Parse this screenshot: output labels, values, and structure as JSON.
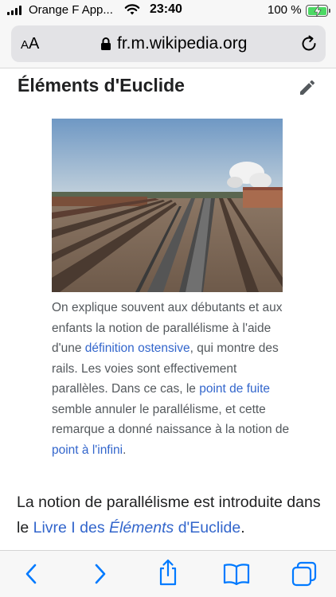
{
  "status_bar": {
    "carrier": "Orange F App...",
    "time": "23:40",
    "battery": "100 %"
  },
  "address_bar": {
    "text_size_label_small": "A",
    "text_size_label_large": "A",
    "url": "fr.m.wikipedia.org"
  },
  "article": {
    "section_title": "Éléments d'Euclide",
    "image_alt": "Photo de voies ferrées parallèles",
    "caption": {
      "part1": "On explique souvent aux débutants et aux enfants la notion de parallélisme à l'aide d'une ",
      "link1": "définition ostensive",
      "part2": ", qui montre des rails. Les voies sont effectivement parallèles. Dans ce cas, le ",
      "link2": "point de fuite",
      "part3": " semble annuler le parallélisme, et cette remarque a donné naissance à la notion de ",
      "link3": "point à l'infini",
      "part4": "."
    },
    "paragraph": {
      "part1": "La notion de parallélisme est introduite dans le ",
      "link_prefix": "Livre I des ",
      "link_italic": "Éléments",
      "link_suffix": " d'Euclide",
      "part2": "."
    }
  },
  "toolbar": {
    "icons": [
      "back-icon",
      "forward-icon",
      "share-icon",
      "bookmarks-icon",
      "tabs-icon"
    ]
  },
  "colors": {
    "link": "#3366cc",
    "text": "#202122",
    "caption": "#54595d",
    "safari_blue": "#007aff"
  }
}
